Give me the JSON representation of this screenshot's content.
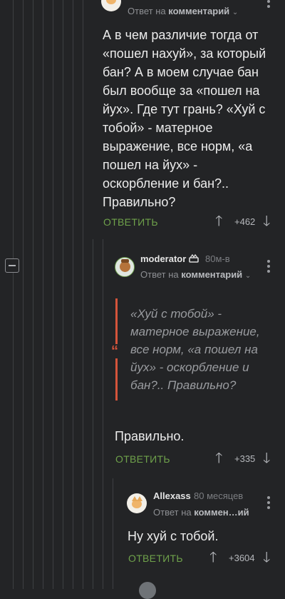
{
  "comment1": {
    "meta_prefix": "Ответ на",
    "meta_target": "комментарий",
    "body": "А в чем различие тогда от «пошел нахуй», за который бан? А в моем случае бан был вообще за «пошел на йух». Где тут грань? «Хуй с тобой» - матерное выражение, все норм, «а пошел на йух» - оскорбление и бан?.. Правильно?",
    "reply_label": "ОТВЕТИТЬ",
    "rating": "+462"
  },
  "comment2": {
    "author": "moderator",
    "time": "80м-в",
    "meta_prefix": "Ответ на",
    "meta_target": "комментарий",
    "quote": "«Хуй с тобой» - матерное выражение, все норм, «а пошел на йух» - оскорбление и бан?.. Правильно?",
    "body": "Правильно.",
    "reply_label": "ОТВЕТИТЬ",
    "rating": "+335"
  },
  "comment3": {
    "author": "Allexass",
    "time": "80 месяцев",
    "meta_prefix": "Ответ на",
    "meta_target": "коммен…ий",
    "body": "Ну хуй с тобой.",
    "reply_label": "ОТВЕТИТЬ",
    "rating": "+3604"
  },
  "icons": {
    "collapse": "minus-icon",
    "upvote": "arrow-up-icon",
    "downvote": "arrow-down-icon",
    "more": "more-vertical-icon",
    "moderator_badge": "crown-icon",
    "quote": "quote-icon"
  },
  "colors": {
    "background": "#232426",
    "accent_green": "#6fa24b",
    "quote_red": "#d4543b"
  }
}
